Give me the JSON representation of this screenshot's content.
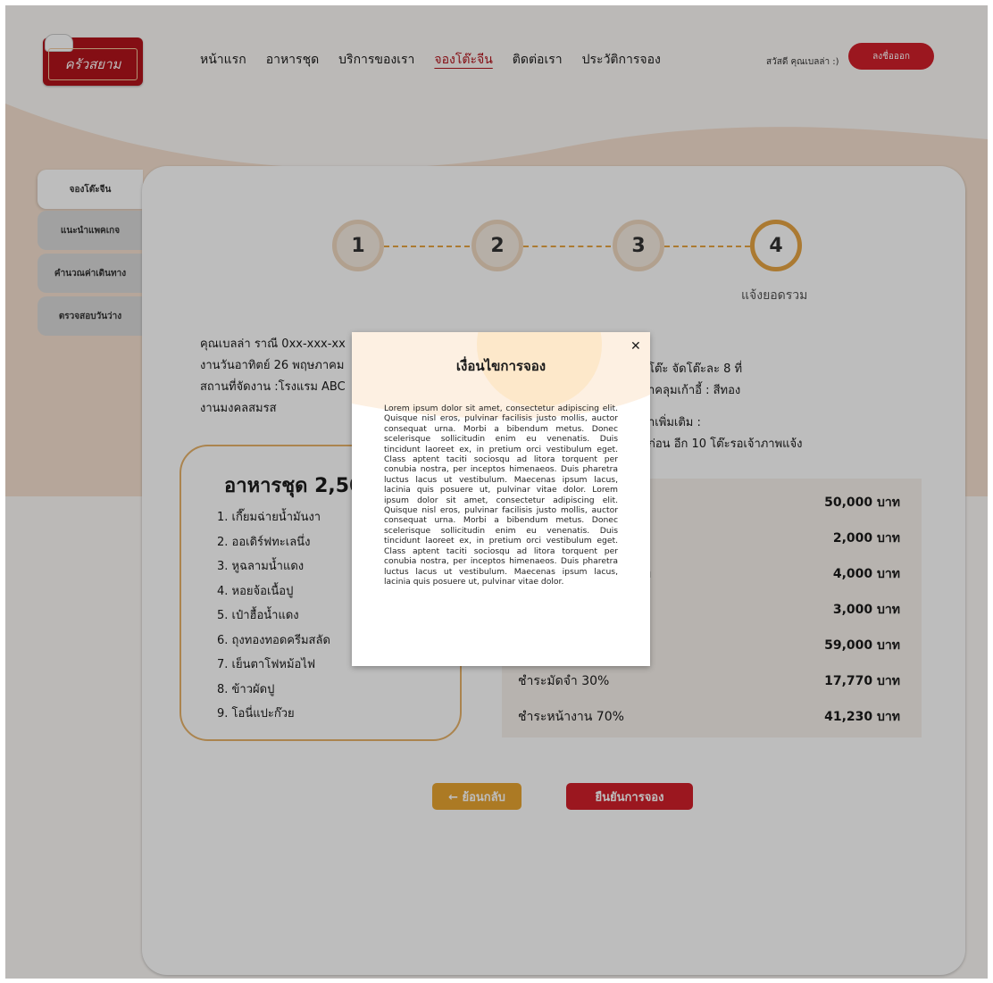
{
  "header": {
    "logo_text": "ครัวสยาม",
    "nav": [
      "หน้าแรก",
      "อาหารชุด",
      "บริการของเรา",
      "จองโต๊ะจีน",
      "ติดต่อเรา",
      "ประวัติการจอง"
    ],
    "greeting": "สวัสดี คุณเบลล่า :)",
    "logout_label": "ลงชื่อออก"
  },
  "sidebar": {
    "items": [
      {
        "label": "จองโต๊ะจีน"
      },
      {
        "label": "แนะนำแพคเกจ"
      },
      {
        "label": "คำนวณค่าเดินทาง"
      },
      {
        "label": "ตรวจสอบวันว่าง"
      }
    ]
  },
  "stepper": {
    "steps": [
      "1",
      "2",
      "3",
      "4"
    ],
    "current_label": "แจ้งยอดรวม"
  },
  "summary": {
    "line1": "คุณเบลล่า ราณี 0xx-xxx-xx",
    "line2": "งานวันอาทิตย์ 26 พฤษภาคม",
    "line3": "สถานที่จัดงาน :โรงแรม ABC",
    "line4": "งานมงคลสมรส",
    "right1": "โต๊ะ จัดโต๊ะละ 8 ที่",
    "right2": "าคลุมเก้าอี้ : สีทอง",
    "right3": "าเพิ่มเติม :",
    "right4": "ก่อน อีก 10 โต๊ะรอเจ้าภาพแจ้ง"
  },
  "menu": {
    "title": "อาหารชุด 2,50",
    "items": [
      "1. เกี๊ยมฉ่ายน้ำมันงา",
      "2. ออเดิร์ฟทะเลนึ่ง",
      "3. หูฉลามน้ำแดง",
      "4. หอยจ้อเนื้อปู",
      "5. เป๋าฮื้อน้ำแดง",
      "6. ถุงทองทอดครีมสลัด",
      "7. เย็นตาโฟหม้อไฟ",
      "8. ข้าวผัดปู",
      "9. โอนี่แปะก๊วย"
    ]
  },
  "price_table": {
    "rows": [
      {
        "label": "",
        "value": "50,000 บาท"
      },
      {
        "label": "",
        "value": "2,000 บาท"
      },
      {
        "label": "าท",
        "value": "4,000 บาท"
      },
      {
        "label": "",
        "value": "3,000 บาท"
      },
      {
        "label": "",
        "value": "59,000 บาท"
      },
      {
        "label": "ชำระมัดจำ 30%",
        "value": "17,770 บาท"
      },
      {
        "label": "ชำระหน้างาน 70%",
        "value": "41,230 บาท"
      }
    ]
  },
  "actions": {
    "back_label": "← ย้อนกลับ",
    "confirm_label": "ยืนยันการจอง"
  },
  "modal": {
    "title": "เงื่อนไขการจอง",
    "close_label": "✕",
    "body": "Lorem ipsum dolor sit amet, consectetur adipiscing elit. Quisque nisl eros, pulvinar facilisis justo mollis, auctor consequat urna. Morbi a bibendum metus. Donec scelerisque sollicitudin enim eu venenatis. Duis tincidunt laoreet ex, in pretium orci vestibulum eget. Class aptent taciti sociosqu ad litora torquent per conubia nostra, per inceptos himenaeos. Duis pharetra luctus lacus ut vestibulum. Maecenas ipsum lacus, lacinia quis posuere ut, pulvinar vitae dolor. Lorem ipsum dolor sit amet, consectetur adipiscing elit. Quisque nisl eros, pulvinar facilisis justo mollis, auctor consequat urna. Morbi a bibendum metus. Donec scelerisque sollicitudin enim eu venenatis. Duis tincidunt laoreet ex, in pretium orci vestibulum eget. Class aptent taciti sociosqu ad litora torquent per conubia nostra, per inceptos himenaeos. Duis pharetra luctus lacus ut vestibulum. Maecenas ipsum lacus, lacinia quis posuere ut, pulvinar vitae dolor."
  },
  "colors": {
    "brand_red": "#d21f2b",
    "accent_orange": "#e9a531",
    "wave": "#f6e1d0"
  }
}
